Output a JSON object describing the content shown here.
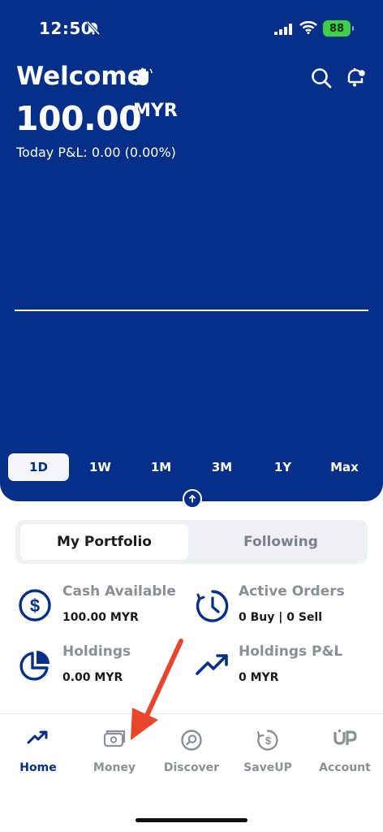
{
  "status": {
    "time": "12:50",
    "battery": "88"
  },
  "header": {
    "greeting": "Welcome",
    "balance": "100.00",
    "currency": "MYR",
    "pnl": "Today P&L: 0.00 (0.00%)"
  },
  "chart": {
    "ranges": [
      "1D",
      "1W",
      "1M",
      "3M",
      "1Y",
      "Max"
    ],
    "selected": "1D"
  },
  "tabs": {
    "portfolio": "My Portfolio",
    "following": "Following"
  },
  "stats": {
    "cash": {
      "title": "Cash Available",
      "value": "100.00 MYR"
    },
    "orders": {
      "title": "Active Orders",
      "value": "0 Buy | 0 Sell"
    },
    "holdings": {
      "title": "Holdings",
      "value": "0.00 MYR"
    },
    "holdings_pnl": {
      "title": "Holdings P&L",
      "value": "0 MYR"
    }
  },
  "nav": {
    "home": "Home",
    "money": "Money",
    "discover": "Discover",
    "saveup": "SaveUP",
    "account": "Account"
  },
  "colors": {
    "brand": "#062f8a",
    "annotation_arrow": "#e8452a",
    "battery": "#3ecf4a"
  }
}
